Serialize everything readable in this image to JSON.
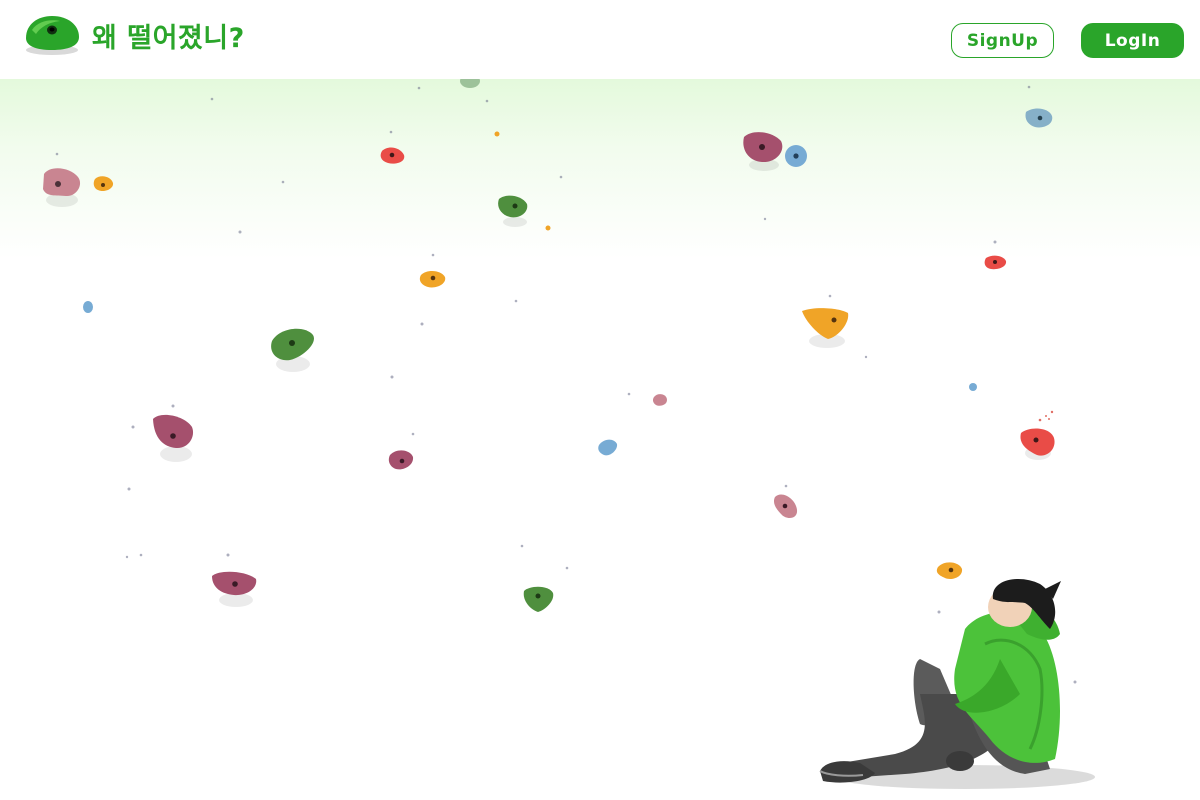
{
  "header": {
    "logo_icon": "climbing-hold-logo-icon",
    "brand_title": "왜 떨어졌니?",
    "signup_label": "SignUp",
    "login_label": "LogIn"
  },
  "colors": {
    "brand_green": "#2aa52a",
    "hold_red": "#e94c47",
    "hold_orange": "#f0a427",
    "hold_green": "#4f8f3e",
    "hold_blue": "#77abd4",
    "hold_maroon": "#a5506d",
    "hold_pink": "#c98591",
    "jacket_green": "#4cc23a"
  },
  "illustration": {
    "subject": "climber-sitting-looking-up-illustration"
  }
}
